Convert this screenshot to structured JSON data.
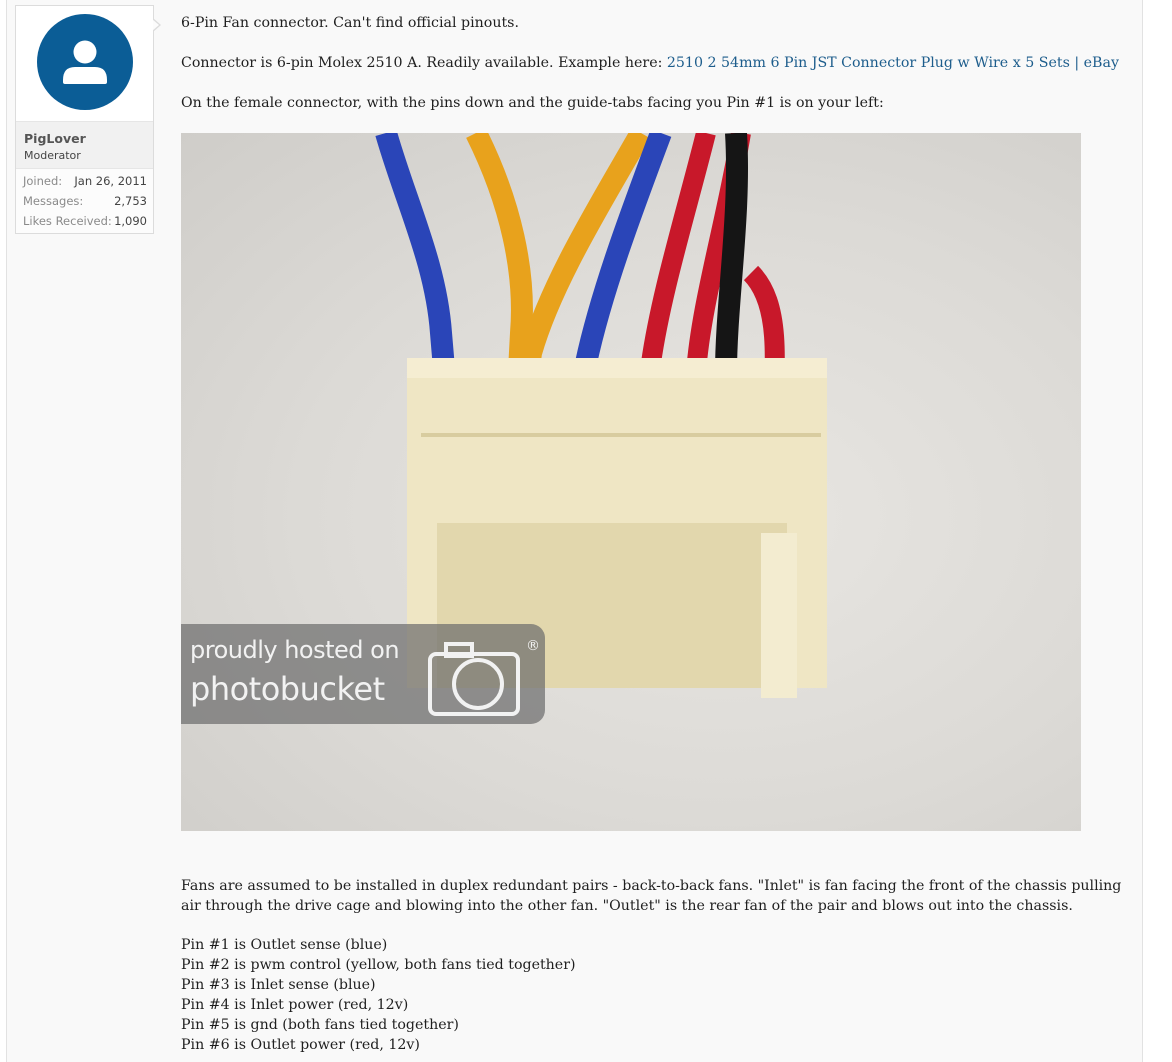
{
  "user": {
    "name": "PigLover",
    "title": "Moderator",
    "stats": [
      {
        "label": "Joined:",
        "value": "Jan 26, 2011"
      },
      {
        "label": "Messages:",
        "value": "2,753"
      },
      {
        "label": "Likes Received:",
        "value": "1,090"
      }
    ],
    "avatar_icon": "user-silhouette-icon"
  },
  "post": {
    "line1": "6-Pin Fan connector. Can't find official pinouts.",
    "line2_text": "Connector is 6-pin Molex 2510 A. Readily available. Example here: ",
    "line2_link": "2510 2 54mm 6 Pin JST Connector Plug w Wire x 5 Sets | eBay",
    "line3": "On the female connector, with the pins down and the guide-tabs facing you Pin #1 is on your left:",
    "image": {
      "watermark_line1": "proudly hosted on",
      "watermark_line2": "photobucket",
      "registered_mark": "®"
    },
    "paragraph": "Fans are assumed to be installed in duplex redundant pairs - back-to-back fans. \"Inlet\" is fan facing the front of the chassis pulling air through the drive cage and blowing into the other fan. \"Outlet\" is the rear fan of the pair and blows out into the chassis.",
    "pins": [
      "Pin #1 is Outlet sense (blue)",
      "Pin #2 is pwm control (yellow, both fans tied together)",
      "Pin #3 is Inlet sense (blue)",
      "Pin #4 is Inlet power (red, 12v)",
      "Pin #5 is gnd (both fans tied together)",
      "Pin #6 is Outlet power (red, 12v)"
    ]
  },
  "colors": {
    "link": "#1d5d8c",
    "avatar_bg": "#0b5d96",
    "wire_blue": "#2a45b8",
    "wire_yellow": "#e8a21c",
    "wire_red": "#c8182a",
    "wire_black": "#151515",
    "connector": "#efe6c4"
  }
}
